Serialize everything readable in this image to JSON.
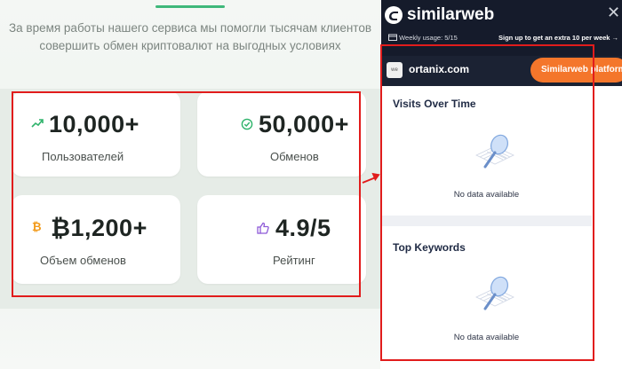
{
  "page": {
    "intro_line1": "За время работы нашего сервиса мы помогли тысячам клиентов",
    "intro_line2": "совершить обмен криптовалют на выгодных условиях"
  },
  "stats": [
    {
      "value": "10,000+",
      "label": "Пользователей",
      "icon": "trend-up-icon",
      "color": "#2fb36b"
    },
    {
      "value": "50,000+",
      "label": "Обменов",
      "icon": "check-circle-icon",
      "color": "#2fb36b"
    },
    {
      "value": "₿1,200+",
      "label": "Объем обменов",
      "icon": "bitcoin-icon",
      "color": "#f29a1a"
    },
    {
      "value": "4.9/5",
      "label": "Рейтинг",
      "icon": "thumbs-up-icon",
      "color": "#8e5bd8"
    }
  ],
  "annotation_color": "#e11c1c",
  "similarweb": {
    "logo_text": "similarweb",
    "weekly_usage": "Weekly usage: 5/15",
    "signup_text": "Sign up to get an extra 10 per week",
    "favicon_text": "we",
    "domain": "ortanix.com",
    "platform_button": "Similarweb platform",
    "accent_color": "#f4762b",
    "header_color": "#151b2b",
    "visits_title": "Visits Over Time",
    "visits_nodata": "No data available",
    "keywords_title": "Top Keywords",
    "keywords_nodata": "No data available"
  }
}
